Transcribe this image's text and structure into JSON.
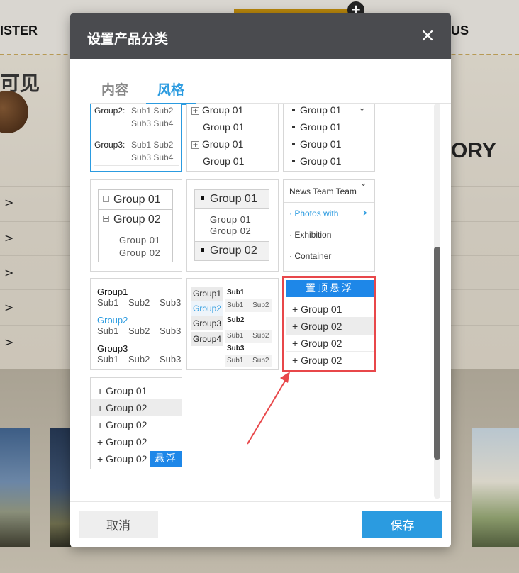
{
  "background": {
    "nav_left": "ISTER",
    "nav_right": "US",
    "visible_text": "可见",
    "story_text": "ORY",
    "plus_icon": "+",
    "arrow_glyph": ">"
  },
  "modal": {
    "title": "设置产品分类",
    "close_glyph": "×",
    "tabs": [
      {
        "label": "内容",
        "active": false
      },
      {
        "label": "风格",
        "active": true
      }
    ],
    "styles": {
      "card1": {
        "group2_label": "Group2:",
        "group2_sub_row1": "Sub1  Sub2",
        "group2_sub_row2": "Sub3  Sub4",
        "group3_label": "Group3:",
        "group3_sub_row1": "Sub1  Sub2",
        "group3_sub_row2": "Sub3  Sub4"
      },
      "card2": {
        "rows": [
          "Group 01",
          "Group 01",
          "Group 01",
          "Group 01"
        ],
        "expander_glyph": "+"
      },
      "card3": {
        "rows": [
          "Group 01",
          "Group 01",
          "Group 01",
          "Group 01"
        ],
        "chevron_glyph": "⌄"
      },
      "card4": {
        "group1": "Group 01",
        "group2": "Group 02",
        "sub1": "Group 01",
        "sub2": "Group 02"
      },
      "card5": {
        "top": "Group 01",
        "sub1": "Group 01",
        "sub2": "Group 02",
        "bottom": "Group 02"
      },
      "card6": {
        "header": "News Team Team",
        "item1": "· Photos with",
        "item2": "· Exhibition",
        "item3": "· Container",
        "chevron_down": "⌄",
        "chevron_right": "›"
      },
      "card7": {
        "groups": [
          {
            "name": "Group1",
            "subs": "Sub1 Sub2 Sub3"
          },
          {
            "name": "Group2",
            "subs": "Sub1 Sub2 Sub3"
          },
          {
            "name": "Group3",
            "subs": "Sub1 Sub2 Sub3"
          }
        ]
      },
      "card8": {
        "groups": [
          "Group1",
          "Group2",
          "Group3",
          "Group4"
        ],
        "sub_labels": [
          "Sub1",
          "Sub2",
          "Sub3"
        ],
        "sub_pairs": [
          "Sub1 Sub2",
          "Sub1 Sub2",
          "Sub1 Sub2"
        ]
      },
      "card9": {
        "top_button": "置顶悬浮",
        "rows": [
          "+ Group 01",
          "+ Group 02",
          "+ Group 02",
          "+ Group 02"
        ]
      },
      "card10": {
        "rows": [
          "+ Group 01",
          "+ Group 02",
          "+ Group 02",
          "+ Group 02",
          "+ Group 02"
        ],
        "float_badge": "悬浮"
      }
    },
    "footer": {
      "cancel_label": "取消",
      "save_label": "保存"
    }
  },
  "colors": {
    "accent": "#2b9be0",
    "header_bg": "#4a4b4f",
    "highlight_red": "#e8474a",
    "button_blue": "#1e87e8"
  }
}
